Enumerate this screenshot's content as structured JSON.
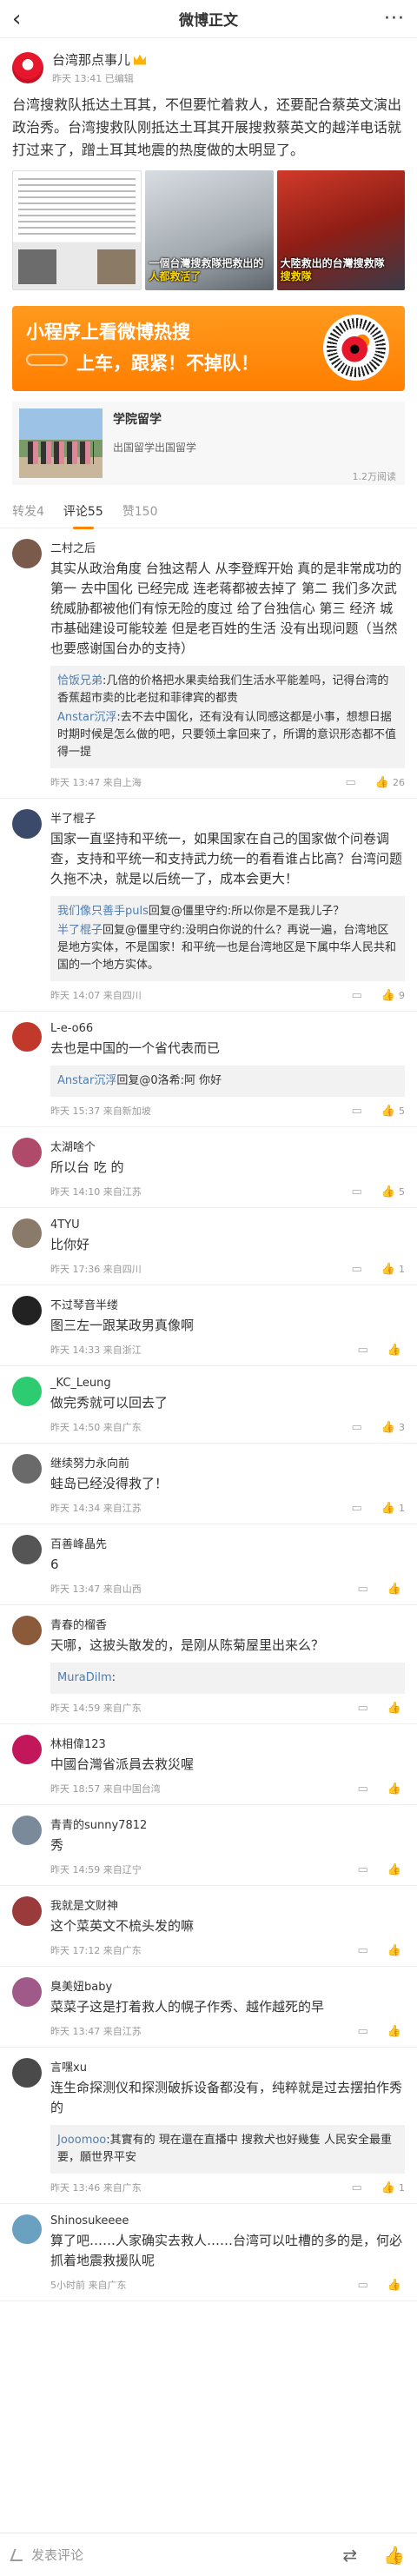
{
  "nav": {
    "back": "‹",
    "title": "微博正文",
    "more": "···"
  },
  "post": {
    "author": "台湾那点事儿",
    "meta": "昨天 13:41 已编辑",
    "text": "台湾搜救队抵达土耳其，不但要忙着救人，还要配合蔡英文演出政治秀。台湾搜救队刚抵达土耳其开展搜救蔡英文的越洋电话就打过来了，蹭土耳其地震的热度做的太明显了。",
    "images": [
      {
        "caption": ""
      },
      {
        "caption_a": "一個台灣搜救隊把救出的",
        "caption_b": "人都救活了",
        "tag": ""
      },
      {
        "caption_a": "大陸救出的台灣搜救隊",
        "caption_b": "搜救隊",
        "tag": ""
      }
    ]
  },
  "banner": {
    "line1": "小程序上看微博热搜",
    "line2": "上车，跟紧！不掉队！"
  },
  "card": {
    "title": "学院留学",
    "subtitle": "出国留学出国留学",
    "views": "1.2万阅读"
  },
  "tabs": {
    "repost": "转发4",
    "comment": "评论55",
    "like": "赞150"
  },
  "comments": [
    {
      "name": "二村之后",
      "text": "其实从政治角度 台独这帮人 从李登辉开始 真的是非常成功的 第一 去中国化 已经完成 连老蒋都被去掉了 第二 我们多次武统威胁都被他们有惊无险的度过 给了台独信心 第三 经济 城市基础建设可能较差 但是老百姓的生活 没有出现问题（当然也要感谢国台办的支持）",
      "replies": [
        {
          "n": "恰饭兄弟",
          "t": ":几倍的价格把水果卖给我们生活水平能差吗，记得台湾的香蕉超市卖的比老挝和菲律宾的都贵"
        },
        {
          "n": "Anstar沉浮",
          "t": ":去不去中国化，还有没有认同感这都是小事，想想日据时期时候是怎么做的吧，只要领土拿回来了，所谓的意识形态都不值得一提"
        }
      ],
      "meta": "昨天 13:47 来自上海",
      "likes": "26",
      "av": "#7a5a4a"
    },
    {
      "name": "半了棍子",
      "text": "国家一直坚持和平统一，如果国家在自己的国家做个问卷调查，支持和平统一和支持武力统一的看看谁占比高？台湾问题久拖不决，就是以后统一了，成本会更大！",
      "replies": [
        {
          "n": "我们像只善手puls",
          "t": "回复@僵里守约:所以你是不是我儿子？"
        },
        {
          "n": "半了棍子",
          "t": "回复@僵里守约:没明白你说的什么？再说一遍，台湾地区是地方实体，不是国家！和平统一也是台湾地区是下属中华人民共和国的一个地方实体。"
        }
      ],
      "meta": "昨天 14:07 来自四川",
      "likes": "9",
      "av": "#3b4a6a"
    },
    {
      "name": "L-e-o66",
      "text": "去也是中国的一个省代表而已",
      "replies": [
        {
          "n": "Anstar沉浮",
          "t": "回复@0洛希:阿 你好"
        }
      ],
      "meta": "昨天 15:37 来自新加坡",
      "likes": "5",
      "av": "#c0392b"
    },
    {
      "name": "太湖啥个",
      "text": "所以台 吃 的",
      "replies": [],
      "meta": "昨天 14:10 来自江苏",
      "likes": "5",
      "av": "#b04a6a"
    },
    {
      "name": "4TYU",
      "text": "比你好",
      "replies": [],
      "meta": "昨天 17:36 来自四川",
      "likes": "1",
      "av": "#8a7a6a"
    },
    {
      "name": "不过琴音半缕",
      "text": "图三左一跟某政男真像啊",
      "replies": [],
      "meta": "昨天 14:33 来自浙江",
      "likes": "",
      "av": "#222"
    },
    {
      "name": "_KC_Leung",
      "text": "做完秀就可以回去了",
      "replies": [],
      "meta": "昨天 14:50 来自广东",
      "likes": "3",
      "av": "#2ecc71"
    },
    {
      "name": "继续努力永向前",
      "text": "蛙岛已经没得救了！",
      "replies": [],
      "meta": "昨天 14:34 来自江苏",
      "likes": "1",
      "av": "#6a6a6a"
    },
    {
      "name": "百善峰晶先",
      "text": "6",
      "replies": [],
      "meta": "昨天 13:47 来自山西",
      "likes": "",
      "av": "#555"
    },
    {
      "name": "青春的榴香",
      "text": "天哪，这披头散发的，是刚从陈菊屋里出来么？",
      "replies": [
        {
          "n": "MuraDilm",
          "t": ":"
        }
      ],
      "meta": "昨天 14:59 来自广东",
      "likes": "",
      "av": "#8a5a3a"
    },
    {
      "name": "林相偉123",
      "text": "中國台灣省派員去救災喔",
      "replies": [],
      "meta": "昨天 18:57 来自中国台湾",
      "likes": "",
      "av": "#c2185b"
    },
    {
      "name": "青青的sunny7812",
      "text": "秀",
      "replies": [],
      "meta": "昨天 14:59 来自辽宁",
      "likes": "",
      "av": "#7a8a9a"
    },
    {
      "name": "我就是文财神",
      "text": "这个菜英文不梳头发的嘛",
      "replies": [],
      "meta": "昨天 17:12 来自广东",
      "likes": "",
      "av": "#9a3a3a"
    },
    {
      "name": "臭美妞baby",
      "text": "菜菜子这是打着救人的幌子作秀、越作越死的早",
      "replies": [],
      "meta": "昨天 13:47 来自江苏",
      "likes": "",
      "av": "#a05a8a"
    },
    {
      "name": "言嘿xu",
      "text": "连生命探测仪和探测破拆设备都没有，纯粹就是过去摆拍作秀的",
      "replies": [
        {
          "n": "Jooomoo",
          "t": ":其實有的 現在還在直播中 搜救犬也好幾隻 人民安全最重要，願世界平安"
        }
      ],
      "meta": "昨天 13:46 来自广东",
      "likes": "1",
      "av": "#4a4a4a"
    },
    {
      "name": "Shinosukeeee",
      "text": "算了吧……人家确实去救人……台湾可以吐槽的多的是，何必抓着地震救援队呢",
      "replies": [],
      "meta": "5小时前 来自广东",
      "likes": "",
      "av": "#6aa0c0"
    }
  ],
  "bottombar": {
    "placeholder": "发表评论",
    "repost_icon": "repost-icon",
    "like_icon": "like-icon"
  }
}
